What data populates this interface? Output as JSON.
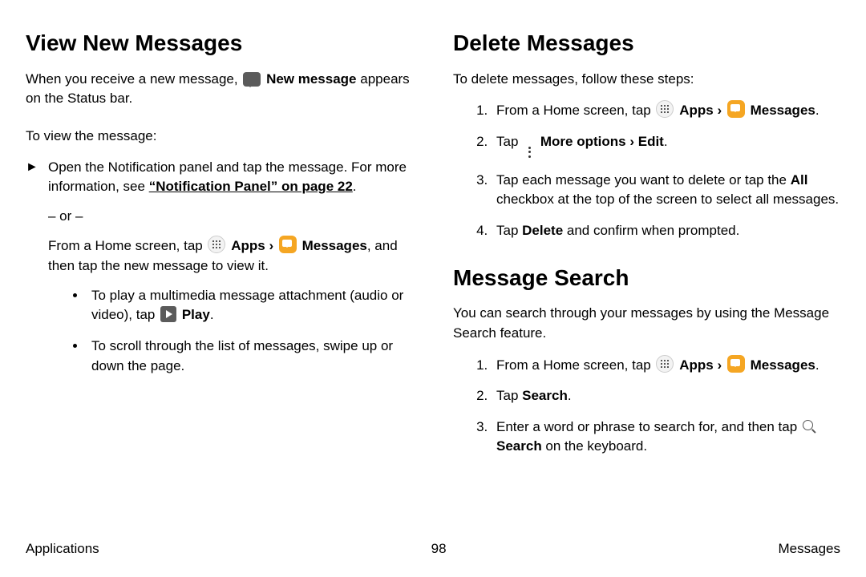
{
  "left": {
    "heading": "View New Messages",
    "intro1": "When you receive a new message,",
    "newMessageLabel": "New message",
    "intro2": "appears on the Status bar.",
    "toView": "To view the message:",
    "openNotif1": "Open the Notification panel and tap the message. For more information, see ",
    "notifLink": "“Notification Panel” on page 22",
    "period": ".",
    "or": "– or –",
    "fromHome1": "From a Home screen, tap ",
    "apps": "Apps",
    "caret": "›",
    "messages": "Messages",
    "fromHome2": ", and then tap the new message to view it.",
    "bullet1a": "To play a multimedia message attachment (audio or video), tap ",
    "play": "Play",
    "bullet2": "To scroll through the list of messages, swipe up or down the page."
  },
  "rightDelete": {
    "heading": "Delete Messages",
    "intro": "To delete messages, follow these steps:",
    "step1a": "From a Home screen, tap ",
    "apps": "Apps",
    "caret": "›",
    "messages": "Messages",
    "step2a": "Tap ",
    "moreOptions": "More options",
    "edit": "Edit",
    "step3a": "Tap each message you want to delete or tap the ",
    "all": "All",
    "step3b": " checkbox at the top of the screen to select all messages.",
    "step4a": "Tap ",
    "delete": "Delete",
    "step4b": " and confirm when prompted."
  },
  "rightSearch": {
    "heading": "Message Search",
    "intro": "You can search through your messages by using the Message Search feature.",
    "step1a": "From a Home screen, tap ",
    "apps": "Apps",
    "caret": "›",
    "messages": "Messages",
    "step2a": "Tap ",
    "search": "Search",
    "step3a": "Enter a word or phrase to search for, and then tap ",
    "searchBtn": "Search",
    "step3b": " on the keyboard."
  },
  "footer": {
    "left": "Applications",
    "center": "98",
    "right": "Messages"
  }
}
